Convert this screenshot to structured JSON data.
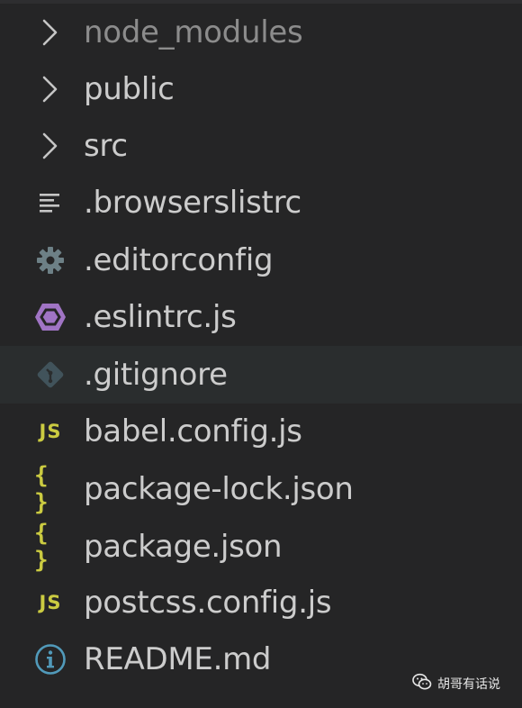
{
  "explorer": {
    "items": [
      {
        "label": "node_modules",
        "icon": "chevron-right-icon",
        "type": "folder"
      },
      {
        "label": "public",
        "icon": "chevron-right-icon",
        "type": "folder"
      },
      {
        "label": "src",
        "icon": "chevron-right-icon",
        "type": "folder"
      },
      {
        "label": ".browserslistrc",
        "icon": "text-lines-icon",
        "type": "file"
      },
      {
        "label": ".editorconfig",
        "icon": "gear-icon",
        "type": "file"
      },
      {
        "label": ".eslintrc.js",
        "icon": "eslint-hexagon-icon",
        "type": "file"
      },
      {
        "label": ".gitignore",
        "icon": "git-diamond-icon",
        "type": "file"
      },
      {
        "label": "babel.config.js",
        "icon": "js-icon",
        "icon_text": "JS",
        "type": "file"
      },
      {
        "label": "package-lock.json",
        "icon": "json-braces-icon",
        "icon_text": "{ }",
        "type": "file"
      },
      {
        "label": "package.json",
        "icon": "json-braces-icon",
        "icon_text": "{ }",
        "type": "file"
      },
      {
        "label": "postcss.config.js",
        "icon": "js-icon",
        "icon_text": "JS",
        "type": "file"
      },
      {
        "label": "README.md",
        "icon": "info-circle-icon",
        "type": "file"
      }
    ],
    "hovered_item": ".gitignore"
  },
  "watermark": {
    "text": "胡哥有话说",
    "icon": "wechat-icon"
  },
  "colors": {
    "background": "#252526",
    "hover_background": "#2a2d2e",
    "label": "#cccccc",
    "dim_label": "#8c8c8c",
    "chevron": "#c5c5c5",
    "gear": "#6d8086",
    "eslint": "#a074c4",
    "git": "#41535b",
    "js": "#cbcb41",
    "json": "#cbcb41",
    "info": "#519aba"
  }
}
